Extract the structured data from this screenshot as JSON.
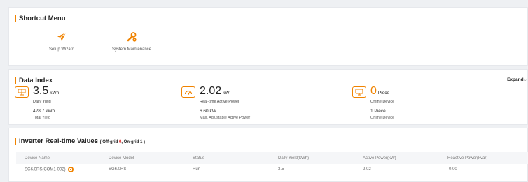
{
  "shortcut_menu": {
    "title": "Shortcut Menu",
    "items": [
      {
        "label": "Setup Wizard",
        "icon": "paper-plane-icon"
      },
      {
        "label": "System Maintenance",
        "icon": "wrench-gear-icon"
      }
    ]
  },
  "data_index": {
    "title": "Data Index",
    "expand_label": "Expand",
    "metrics": [
      {
        "icon": "solar-panel-icon",
        "value": "3.5",
        "unit": "kWh",
        "label": "Daily Yield",
        "sub_value": "428.7 kWh",
        "sub_label": "Total Yield"
      },
      {
        "icon": "gauge-icon",
        "value": "2.02",
        "unit": "kW",
        "label": "Real-time Active Power",
        "sub_value": "6.60 kW",
        "sub_label": "Max. Adjustable Active Power"
      },
      {
        "icon": "monitor-icon",
        "value": "0",
        "unit": "Piece",
        "label": "Offline Device",
        "sub_value": "1 Piece",
        "sub_label": "Online Device"
      }
    ]
  },
  "inverter": {
    "title": "Inverter Real-time Values",
    "counts_prefix": "( Off-grid ",
    "offgrid_count": "0",
    "counts_middle": ", On-grid ",
    "ongrid_count": "1",
    "counts_suffix": " )",
    "columns": [
      "Device Name",
      "Device Model",
      "Status",
      "Daily Yield(kWh)",
      "Active Power(kW)",
      "Reactive Power(kvar)"
    ],
    "rows": [
      [
        "SG6.0RS(COM1-002)",
        "SG6.0RS",
        "Run",
        "3.5",
        "2.02",
        "-0.00"
      ]
    ]
  },
  "colors": {
    "accent": "#f08300",
    "offgrid": "#e0201e",
    "background": "#eef0f3"
  }
}
